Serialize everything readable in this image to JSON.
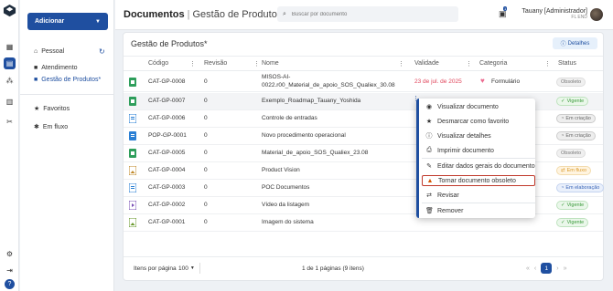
{
  "sidebar": {
    "add_label": "Adicionar",
    "personal_label": "Pessoal",
    "items": [
      {
        "label": "Atendimento"
      },
      {
        "label": "Gestão de Produtos*"
      }
    ],
    "favorites_label": "Favoritos",
    "inflow_label": "Em fluxo"
  },
  "header": {
    "title": "Documentos",
    "subtitle": "Gestão de Produtos*",
    "search_placeholder": "Buscar por documento",
    "notif_count": "1",
    "user_name": "Tauany [Administrador]",
    "user_org": "FL END"
  },
  "card": {
    "title": "Gestão de Produtos*",
    "details_label": "Detalhes"
  },
  "table": {
    "columns": [
      "Código",
      "Revisão",
      "Nome",
      "Validade",
      "Categoria",
      "Status"
    ],
    "rows": [
      {
        "code": "CAT-GP-0008",
        "rev": "0",
        "name1": "MISOS-AI-",
        "name2": "0022.r00_Material_de_apoio_SOS_Qualiex_30.08",
        "validity": "23 de jul. de 2025",
        "category": "Formulário",
        "status": "Obsoleto"
      },
      {
        "code": "CAT-GP-0007",
        "rev": "0",
        "name": "Exemplo_Roadmap_Tauany_Yoshida",
        "validity": "",
        "category": "",
        "status": "Vigente"
      },
      {
        "code": "CAT-GP-0006",
        "rev": "0",
        "name": "Controle de entradas",
        "validity": "",
        "category": "",
        "status": "Em criação"
      },
      {
        "code": "POP-GP-0001",
        "rev": "0",
        "name": "Novo procedimento operacional",
        "validity": "",
        "category": "",
        "status": "Em criação"
      },
      {
        "code": "CAT-GP-0005",
        "rev": "0",
        "name": "Material_de_apoio_SOS_Qualiex_23.08",
        "validity": "",
        "category": "",
        "status": "Obsoleto"
      },
      {
        "code": "CAT-GP-0004",
        "rev": "0",
        "name": "Product Vision",
        "validity": "",
        "category": "",
        "status": "Em fluxo"
      },
      {
        "code": "CAT-GP-0003",
        "rev": "0",
        "name": "POC Documentos",
        "validity": "",
        "category": "",
        "status": "Em elaboração"
      },
      {
        "code": "CAT-GP-0002",
        "rev": "0",
        "name": "Vídeo da listagem",
        "validity": "",
        "category": "",
        "status": "Vigente"
      },
      {
        "code": "CAT-GP-0001",
        "rev": "0",
        "name": "Imagem do sistema",
        "validity": "",
        "category": "",
        "status": "Vigente"
      }
    ]
  },
  "footer": {
    "per_page_label": "Itens por página",
    "per_page_value": "100",
    "page_info": "1 de 1 páginas (9 itens)",
    "current_page": "1"
  },
  "context_menu": {
    "items": [
      {
        "label": "Visualizar documento",
        "icon": "eye-icon"
      },
      {
        "label": "Desmarcar como favorito",
        "icon": "star-icon"
      },
      {
        "label": "Visualizar detalhes",
        "icon": "info-icon"
      },
      {
        "label": "Imprimir documento",
        "icon": "print-icon"
      },
      {
        "label": "Editar dados gerais do documento",
        "icon": "edit-icon"
      },
      {
        "label": "Tornar documento obsoleto",
        "icon": "warning-icon"
      },
      {
        "label": "Revisar",
        "icon": "review-icon"
      },
      {
        "label": "Remover",
        "icon": "trash-icon"
      }
    ]
  },
  "colors": {
    "brand": "#1f4fa0",
    "validity_red": "#e0455b",
    "menu_highlight": "#c0392b"
  }
}
